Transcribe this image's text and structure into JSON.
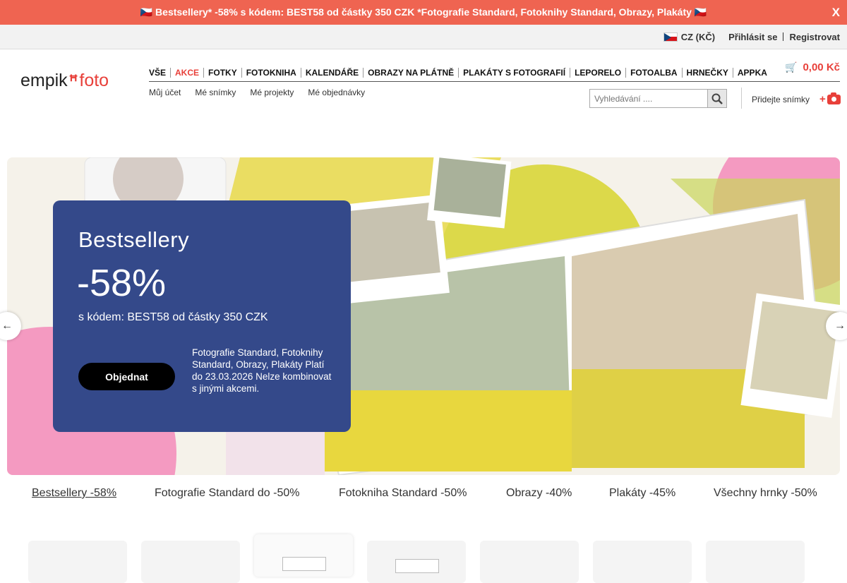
{
  "promo": {
    "text": "🇨🇿 Bestsellery* -58% s kódem: BEST58 od částky 350 CZK *Fotografie Standard, Fotoknihy Standard, Obrazy, Plakáty 🇨🇿",
    "close": "X",
    "bg": "#ef6451"
  },
  "account": {
    "language": "CZ (KČ)",
    "login": "Přihlásit se",
    "register": "Registrovat"
  },
  "logo": {
    "left": "empik",
    "right": "foto",
    "accent": "#e8403a"
  },
  "nav": {
    "items": [
      "VŠE",
      "AKCE",
      "FOTKY",
      "FOTOKNIHA",
      "KALENDÁŘE",
      "OBRAZY NA PLÁTNĚ",
      "PLAKÁTY S FOTOGRAFIÍ",
      "LEPORELO",
      "FOTOALBA",
      "HRNEČKY",
      "APPKA"
    ],
    "active": "AKCE"
  },
  "cart": {
    "total": "0,00 Kč",
    "icon": "cart-icon"
  },
  "subnav": [
    "Můj účet",
    "Mé snímky",
    "Mé projekty",
    "Mé objednávky"
  ],
  "search": {
    "placeholder": "Vyhledávání ....",
    "icon": "search-icon"
  },
  "upload": {
    "label": "Přidejte snímky",
    "plus": "+",
    "icon": "camera-icon"
  },
  "hero": {
    "title": "Bestsellery",
    "discount": "-58%",
    "code_text": "s kódem: BEST58 od částky 350 CZK",
    "cta": "Objednat",
    "note": "Fotografie Standard, Fotoknihy Standard, Obrazy, Plakáty Platí do 23.03.2026 Nelze kombinovat s jinými akcemi.",
    "card_color": "#34498a",
    "prev": "←",
    "next": "→"
  },
  "tabs": [
    "Bestsellery -58%",
    "Fotografie Standard do -50%",
    "Fotokniha Standard -50%",
    "Obrazy -40%",
    "Plakáty -45%",
    "Všechny hrnky -50%"
  ]
}
